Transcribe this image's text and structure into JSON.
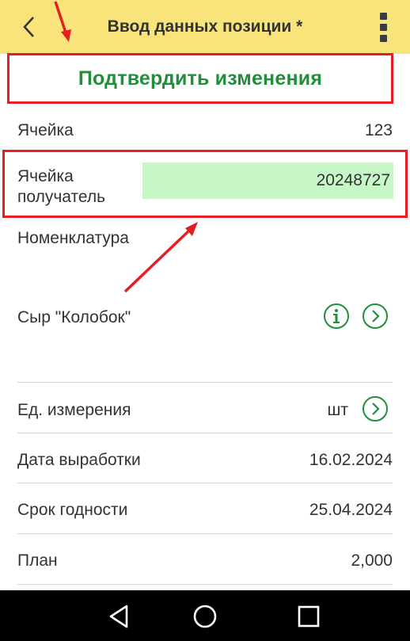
{
  "header": {
    "title": "Ввод данных позиции *",
    "background": "#f8e47a"
  },
  "confirm": {
    "label": "Подтвердить изменения",
    "color": "#1f8f3c"
  },
  "fields": {
    "cell": {
      "label": "Ячейка",
      "value": "123"
    },
    "recipient_cell": {
      "label_line1": "Ячейка",
      "label_line2": "получатель",
      "value": "20248727"
    },
    "nomenclature": {
      "label": "Номенклатура",
      "value": "Сыр \"Колобок\""
    },
    "unit": {
      "label": "Ед. измерения",
      "value": "шт"
    },
    "production_date": {
      "label": "Дата выработки",
      "value": "16.02.2024"
    },
    "expiry_date": {
      "label": "Срок годности",
      "value": "25.04.2024"
    },
    "plan": {
      "label": "План",
      "value": "2,000"
    }
  },
  "icons": {
    "back": "chevron-left-icon",
    "menu": "kebab-menu-icon",
    "info": "info-circle-icon",
    "open": "chevron-right-circle-icon",
    "nav_back": "triangle-back-icon",
    "nav_home": "circle-home-icon",
    "nav_recent": "square-recent-icon"
  },
  "colors": {
    "accent_green": "#1f8f3c",
    "highlight_red": "#e31e24",
    "field_green": "#c7f7c7"
  }
}
